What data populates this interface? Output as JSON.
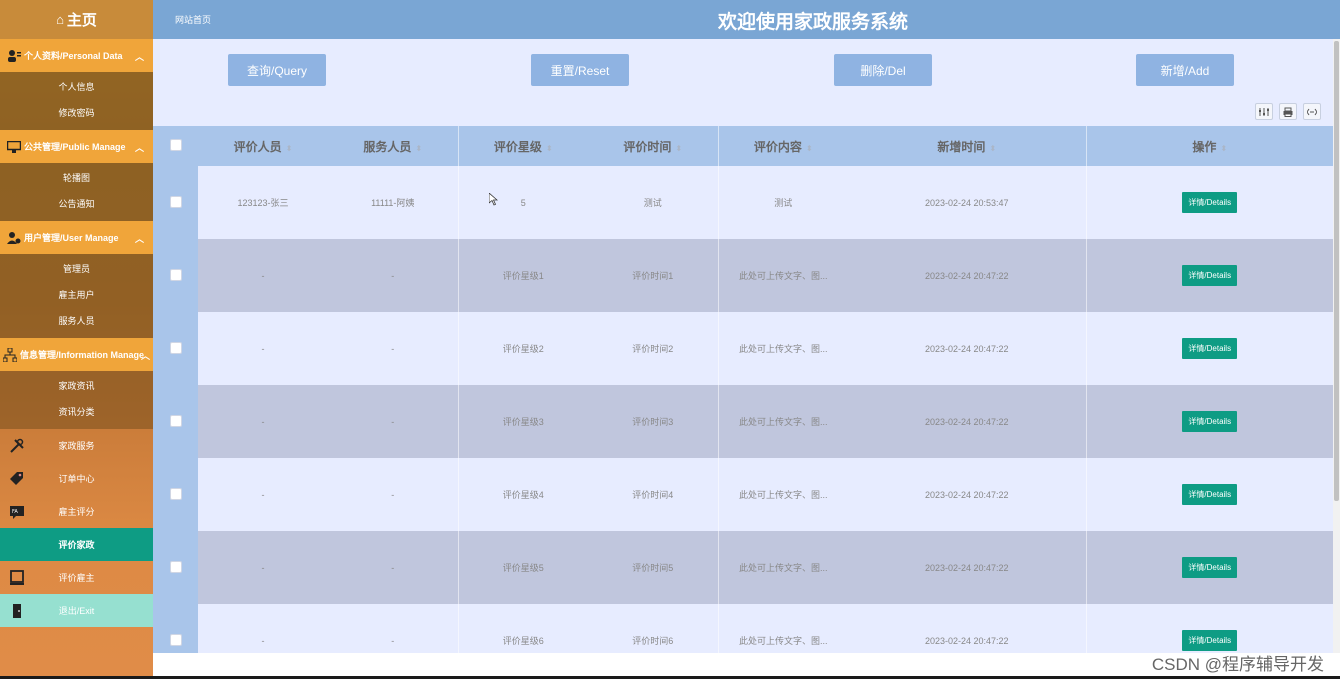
{
  "sidebar": {
    "home": "主页",
    "groups": [
      {
        "label": "个人资料/Personal Data",
        "items": [
          "个人信息",
          "修改密码"
        ]
      },
      {
        "label": "公共管理/Public Manage",
        "items": [
          "轮播图",
          "公告通知"
        ]
      },
      {
        "label": "用户管理/User Manage",
        "items": [
          "管理员",
          "雇主用户",
          "服务人员"
        ]
      },
      {
        "label": "信息管理/Information Manage",
        "items": [
          "家政资讯",
          "资讯分类"
        ]
      }
    ],
    "plain": [
      {
        "label": "家政服务",
        "icon": "tools-icon"
      },
      {
        "label": "订单中心",
        "icon": "tag-icon"
      },
      {
        "label": "雇主评分",
        "icon": "rating-icon"
      },
      {
        "label": "评价家政",
        "icon": "",
        "active": true
      },
      {
        "label": "评价雇主",
        "icon": "monitor-icon"
      },
      {
        "label": "退出/Exit",
        "icon": "door-icon"
      }
    ]
  },
  "header": {
    "breadcrumb": "网站首页",
    "title": "欢迎使用家政服务系统"
  },
  "toolbar": {
    "query": "查询/Query",
    "reset": "重置/Reset",
    "delete": "删除/Del",
    "add": "新增/Add"
  },
  "table": {
    "columns": [
      "评价人员",
      "服务人员",
      "评价星级",
      "评价时间",
      "评价内容",
      "新增时间",
      "操作"
    ],
    "details_label": "详情/Details",
    "rows": [
      {
        "reviewer": "123123-张三",
        "staff": "11111-阿姨",
        "stars": "5",
        "time": "测试",
        "content": "测试",
        "created": "2023-02-24 20:53:47"
      },
      {
        "reviewer": "-",
        "staff": "-",
        "stars": "评价星级1",
        "time": "评价时间1",
        "content": "此处可上传文字、图...",
        "created": "2023-02-24 20:47:22"
      },
      {
        "reviewer": "-",
        "staff": "-",
        "stars": "评价星级2",
        "time": "评价时间2",
        "content": "此处可上传文字、图...",
        "created": "2023-02-24 20:47:22"
      },
      {
        "reviewer": "-",
        "staff": "-",
        "stars": "评价星级3",
        "time": "评价时间3",
        "content": "此处可上传文字、图...",
        "created": "2023-02-24 20:47:22"
      },
      {
        "reviewer": "-",
        "staff": "-",
        "stars": "评价星级4",
        "time": "评价时间4",
        "content": "此处可上传文字、图...",
        "created": "2023-02-24 20:47:22"
      },
      {
        "reviewer": "-",
        "staff": "-",
        "stars": "评价星级5",
        "time": "评价时间5",
        "content": "此处可上传文字、图...",
        "created": "2023-02-24 20:47:22"
      },
      {
        "reviewer": "-",
        "staff": "-",
        "stars": "评价星级6",
        "time": "评价时间6",
        "content": "此处可上传文字、图...",
        "created": "2023-02-24 20:47:22"
      }
    ]
  },
  "watermark": "CSDN @程序辅导开发",
  "colors": {
    "header": "#7aa6d4",
    "button": "#8fb3e2",
    "accent": "#0e9c84",
    "sidebar_group": "#f0a53a"
  }
}
